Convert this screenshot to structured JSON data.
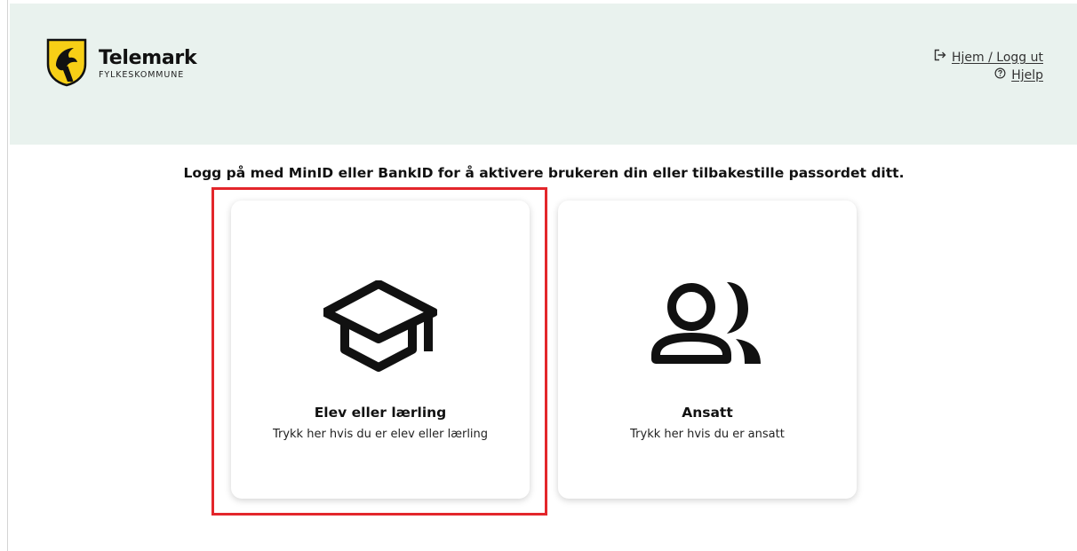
{
  "header": {
    "brand_title": "Telemark",
    "brand_subtitle": "FYLKESKOMMUNE",
    "logo_icon": "telemark-coat-of-arms-icon",
    "links": {
      "home_logout": "Hjem / Logg ut",
      "help": "Hjelp"
    },
    "home_icon": "logout-arrow-icon",
    "help_icon": "question-circle-icon"
  },
  "main": {
    "lead_text": "Logg på med MinID eller BankID for å aktivere brukeren din eller tilbakestille passordet ditt.",
    "cards": [
      {
        "title": "Elev eller lærling",
        "subtitle": "Trykk her hvis du er elev eller lærling",
        "icon": "graduation-cap-icon"
      },
      {
        "title": "Ansatt",
        "subtitle": "Trykk her hvis du er ansatt",
        "icon": "people-icon"
      }
    ]
  },
  "colors": {
    "header_background": "#e9f2ee",
    "highlight_border": "#e3262b",
    "logo_yellow": "#f7cf16"
  }
}
